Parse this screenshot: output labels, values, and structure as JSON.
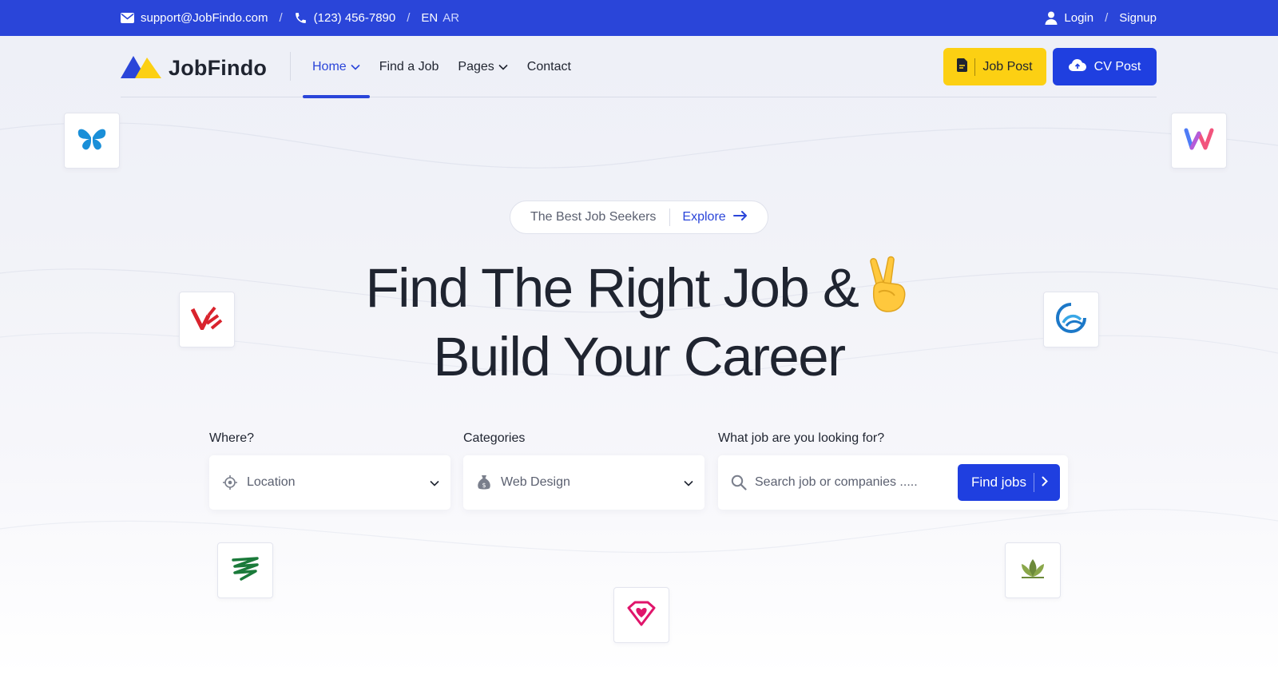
{
  "topbar": {
    "email": "support@JobFindo.com",
    "phone": "(123) 456-7890",
    "sep": "/",
    "lang_en": "EN",
    "lang_ar": "AR",
    "login": "Login",
    "signup": "Signup",
    "color": "#2a45d9"
  },
  "header": {
    "logo_text": "JobFindo",
    "nav": [
      {
        "label": "Home",
        "active": true,
        "dropdown": true
      },
      {
        "label": "Find a Job",
        "active": false,
        "dropdown": false
      },
      {
        "label": "Pages",
        "active": false,
        "dropdown": true
      },
      {
        "label": "Contact",
        "active": false,
        "dropdown": false
      }
    ],
    "job_post": "Job Post",
    "cv_post": "CV Post"
  },
  "hero": {
    "pill_text": "The Best Job Seekers",
    "pill_link": "Explore",
    "headline_line1": "Find The Right Job &",
    "headline_line2": "Build Your Career",
    "emoji_icon": "victory-hand-icon"
  },
  "search": {
    "where_label": "Where?",
    "where_value": "Location",
    "categories_label": "Categories",
    "categories_value": "Web Design",
    "what_label": "What job are you looking for?",
    "what_placeholder": "Search job or companies .....",
    "find_button": "Find jobs"
  },
  "company_logos": [
    "butterfly-logo-icon",
    "w-gradient-logo-icon",
    "v-red-logo-icon",
    "wave-blue-logo-icon",
    "green-scribble-logo-icon",
    "lotus-logo-icon",
    "heart-diamond-logo-icon"
  ],
  "colors": {
    "primary": "#1f3fe0",
    "accent_yellow": "#fcd013",
    "text": "#1f2430"
  }
}
